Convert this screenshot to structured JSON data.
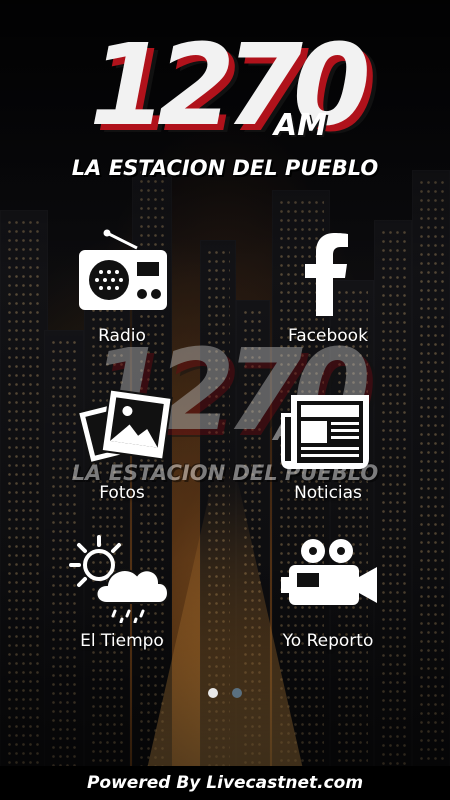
{
  "logo": {
    "number": "1270",
    "band": "AM",
    "tagline": "LA ESTACION DEL PUEBLO"
  },
  "menu": [
    {
      "label": "Radio",
      "icon": "radio-icon"
    },
    {
      "label": "Facebook",
      "icon": "facebook-icon"
    },
    {
      "label": "Fotos",
      "icon": "photos-icon"
    },
    {
      "label": "Noticias",
      "icon": "newspaper-icon"
    },
    {
      "label": "El Tiempo",
      "icon": "weather-icon"
    },
    {
      "label": "Yo Reporto",
      "icon": "video-camera-icon"
    }
  ],
  "pager": {
    "current_page": 1,
    "total_pages": 2
  },
  "footer": {
    "text": "Powered By Livecastnet.com"
  },
  "colors": {
    "accent_red": "#b0121b",
    "icon_white": "#ffffff"
  }
}
